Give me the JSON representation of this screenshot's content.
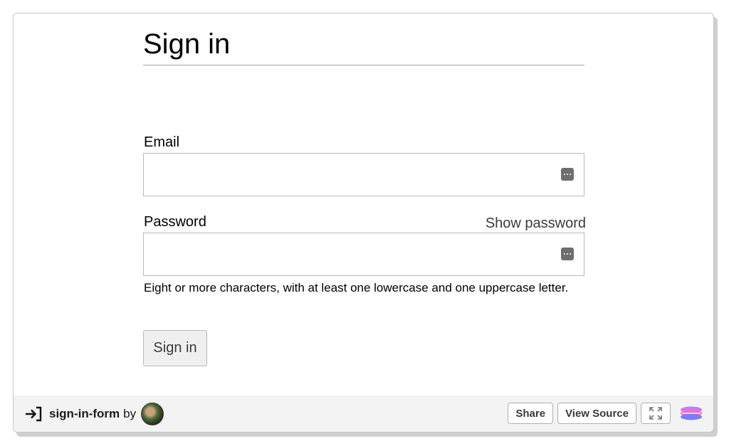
{
  "form": {
    "title": "Sign in",
    "email_label": "Email",
    "email_value": "",
    "password_label": "Password",
    "password_value": "",
    "show_password_label": "Show password",
    "password_hint": "Eight or more characters, with at least one lowercase and one uppercase letter.",
    "submit_label": "Sign in",
    "icons": {
      "autofill": "password-manager-key-icon"
    }
  },
  "footer": {
    "pen_name": "sign-in-form",
    "by_label": "by",
    "share_label": "Share",
    "view_source_label": "View Source",
    "icons": {
      "pen": "enter-arrow-icon",
      "expand": "expand-arrows-icon",
      "logo": "embed-logo-icon"
    }
  },
  "colors": {
    "background": "#ffffff",
    "footer": "#f3f3f3",
    "border": "#b9b9b9",
    "button_bg": "#efefef",
    "text_muted": "#3a3a3a"
  }
}
